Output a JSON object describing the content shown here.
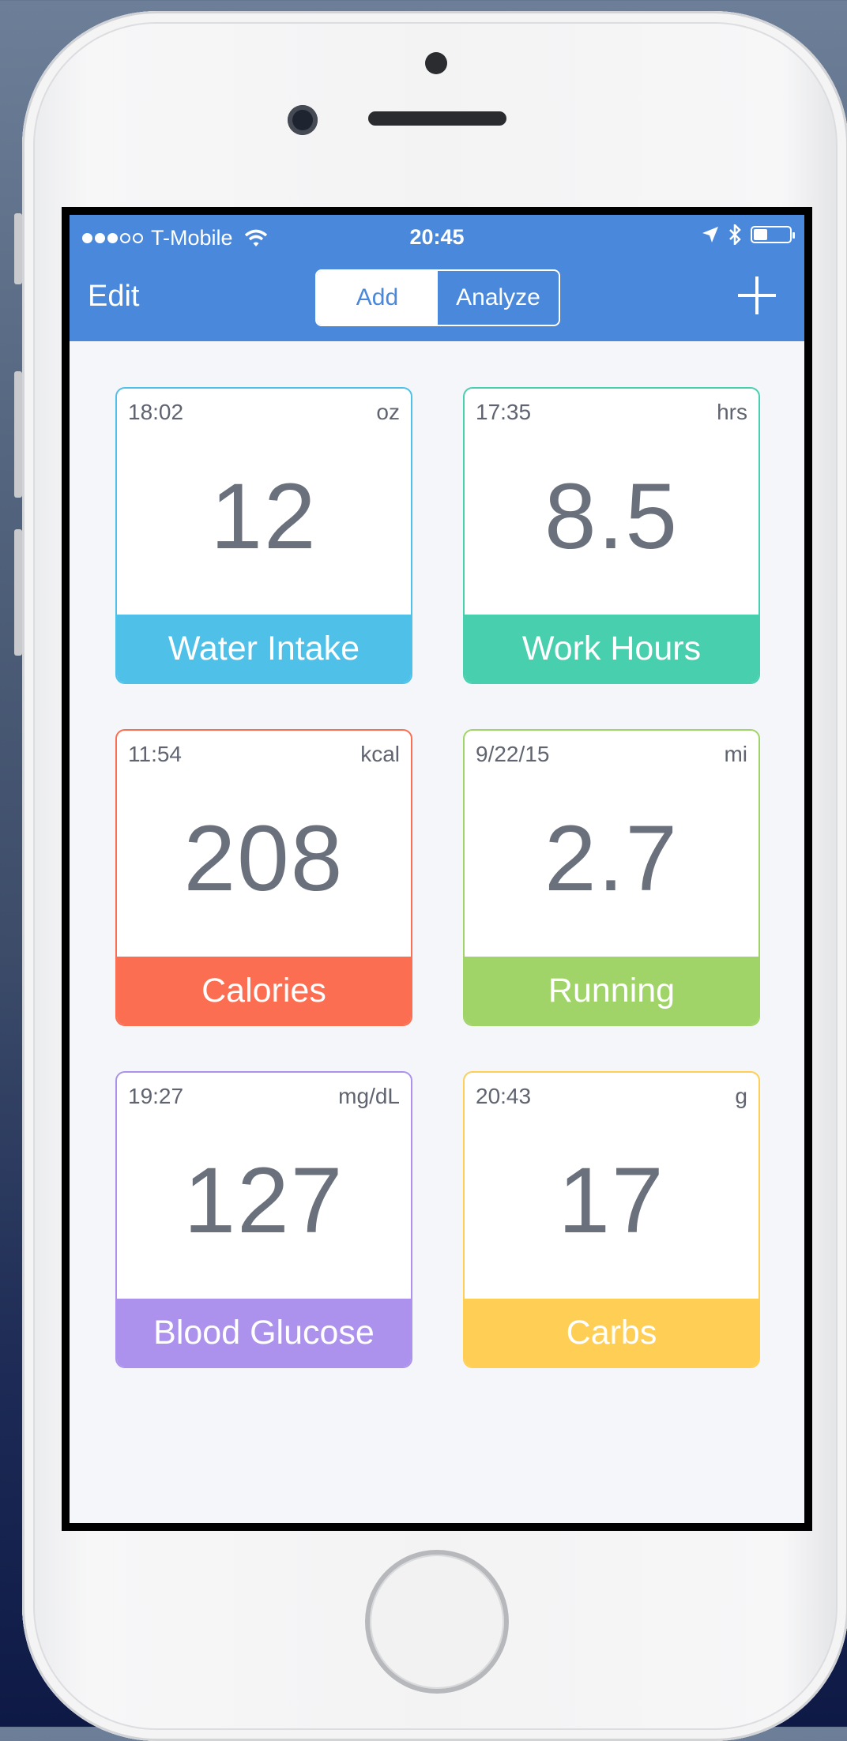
{
  "status_bar": {
    "carrier": "T-Mobile",
    "time": "20:45",
    "battery_level": 0.35
  },
  "navbar": {
    "edit_label": "Edit",
    "segments": [
      "Add",
      "Analyze"
    ],
    "selected_segment": "Add",
    "accent_color": "#4a88db"
  },
  "trackers": [
    {
      "time": "18:02",
      "unit": "oz",
      "value": "12",
      "label": "Water Intake",
      "color": "#4fc1e9"
    },
    {
      "time": "17:35",
      "unit": "hrs",
      "value": "8.5",
      "label": "Work Hours",
      "color": "#48cfad"
    },
    {
      "time": "11:54",
      "unit": "kcal",
      "value": "208",
      "label": "Calories",
      "color": "#fc6e51"
    },
    {
      "time": "9/22/15",
      "unit": "mi",
      "value": "2.7",
      "label": "Running",
      "color": "#a0d468"
    },
    {
      "time": "19:27",
      "unit": "mg/dL",
      "value": "127",
      "label": "Blood Glucose",
      "color": "#ac92ec"
    },
    {
      "time": "20:43",
      "unit": "g",
      "value": "17",
      "label": "Carbs",
      "color": "#ffce54"
    }
  ]
}
